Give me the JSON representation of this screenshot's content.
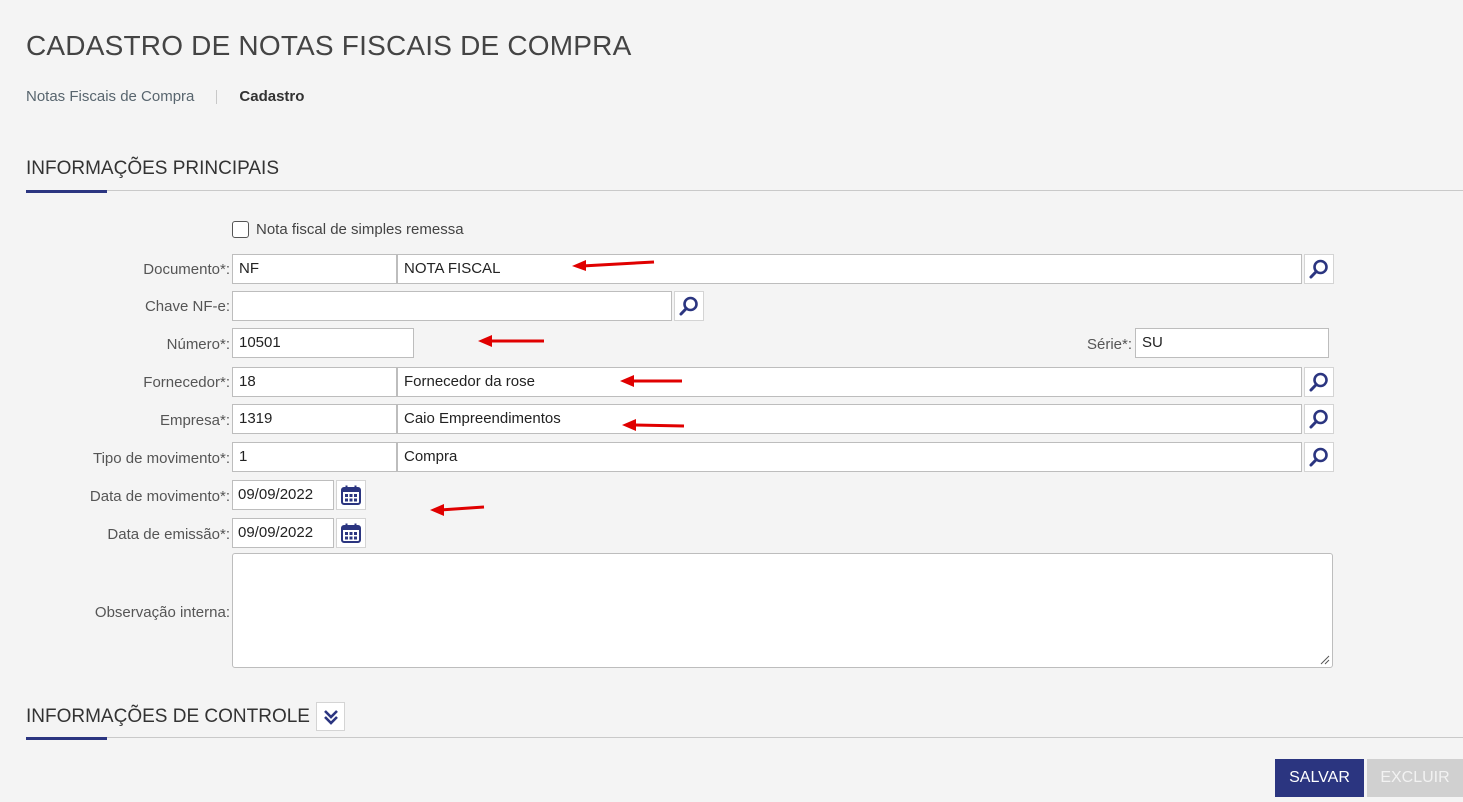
{
  "page": {
    "title": "CADASTRO DE NOTAS FISCAIS DE COMPRA"
  },
  "breadcrumb": {
    "parent": "Notas Fiscais de Compra",
    "current": "Cadastro"
  },
  "sections": {
    "main": "INFORMAÇÕES PRINCIPAIS",
    "control": "INFORMAÇÕES DE CONTROLE"
  },
  "form": {
    "simples_remessa": {
      "label": "Nota fiscal de simples remessa",
      "checked": false
    },
    "documento": {
      "label": "Documento*:",
      "code": "NF",
      "description": "NOTA FISCAL"
    },
    "chave_nfe": {
      "label": "Chave NF-e:",
      "value": ""
    },
    "numero": {
      "label": "Número*:",
      "value": "10501"
    },
    "serie": {
      "label": "Série*:",
      "value": "SU"
    },
    "fornecedor": {
      "label": "Fornecedor*:",
      "code": "18",
      "description": "Fornecedor da rose"
    },
    "empresa": {
      "label": "Empresa*:",
      "code": "1319",
      "description": "Caio Empreendimentos"
    },
    "tipo_movimento": {
      "label": "Tipo de movimento*:",
      "code": "1",
      "description": "Compra"
    },
    "data_movimento": {
      "label": "Data de movimento*:",
      "value": "09/09/2022"
    },
    "data_emissao": {
      "label": "Data de emissão*:",
      "value": "09/09/2022"
    },
    "observacao": {
      "label": "Observação interna:",
      "value": ""
    }
  },
  "actions": {
    "save": "SALVAR",
    "delete": "EXCLUIR"
  },
  "colors": {
    "accent": "#2b3580",
    "annotation_arrow": "#e00000",
    "disabled": "#d0d0d0"
  },
  "icons": {
    "search": "magnifier-icon",
    "calendar": "calendar-icon",
    "expand": "chevron-double-down-icon"
  }
}
